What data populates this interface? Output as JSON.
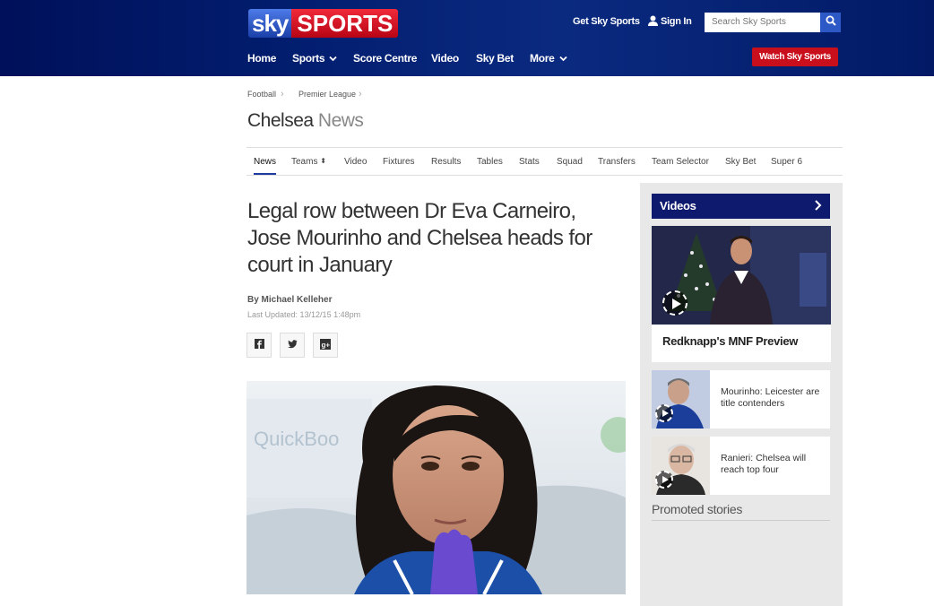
{
  "header": {
    "logo_sky": "sky",
    "logo_sports": "SPORTS",
    "get_sky_sports": "Get Sky Sports",
    "sign_in": "Sign In",
    "search_placeholder": "Search Sky Sports",
    "watch_button": "Watch Sky Sports",
    "nav": [
      {
        "label": "Home"
      },
      {
        "label": "Sports",
        "has_dropdown": true
      },
      {
        "label": "Score Centre"
      },
      {
        "label": "Video"
      },
      {
        "label": "Sky Bet"
      },
      {
        "label": "More",
        "has_dropdown": true
      }
    ],
    "colors": {
      "brand_blue": "#0d1a6e",
      "brand_red": "#c90f1c",
      "search_btn": "#2c59c6"
    }
  },
  "breadcrumb": [
    "Football",
    "Premier League"
  ],
  "page_title": {
    "main": "Chelsea",
    "sub": "News"
  },
  "subnav": {
    "items": [
      "News",
      "Teams",
      "Video",
      "Fixtures",
      "Results",
      "Tables",
      "Stats",
      "Squad",
      "Transfers",
      "Team Selector",
      "Sky Bet",
      "Super 6"
    ],
    "active": "News"
  },
  "article": {
    "headline": "Legal row between Dr Eva Carneiro, Jose Mourinho and Chelsea heads for court in January",
    "byline": "By Michael Kelleher",
    "updated": "Last Updated: 13/12/15 1:48pm",
    "share_icons": [
      "facebook-icon",
      "twitter-icon",
      "google-plus-icon"
    ],
    "share_glyphs": {
      "facebook": "f",
      "twitter": "t",
      "google": "g+"
    }
  },
  "sidebar": {
    "videos_title": "Videos",
    "main_video_title": "Redknapp's MNF Preview",
    "small_videos": [
      {
        "title": "Mourinho: Leicester are title contenders"
      },
      {
        "title": "Ranieri: Chelsea will reach top four"
      }
    ],
    "promoted_title": "Promoted stories"
  }
}
